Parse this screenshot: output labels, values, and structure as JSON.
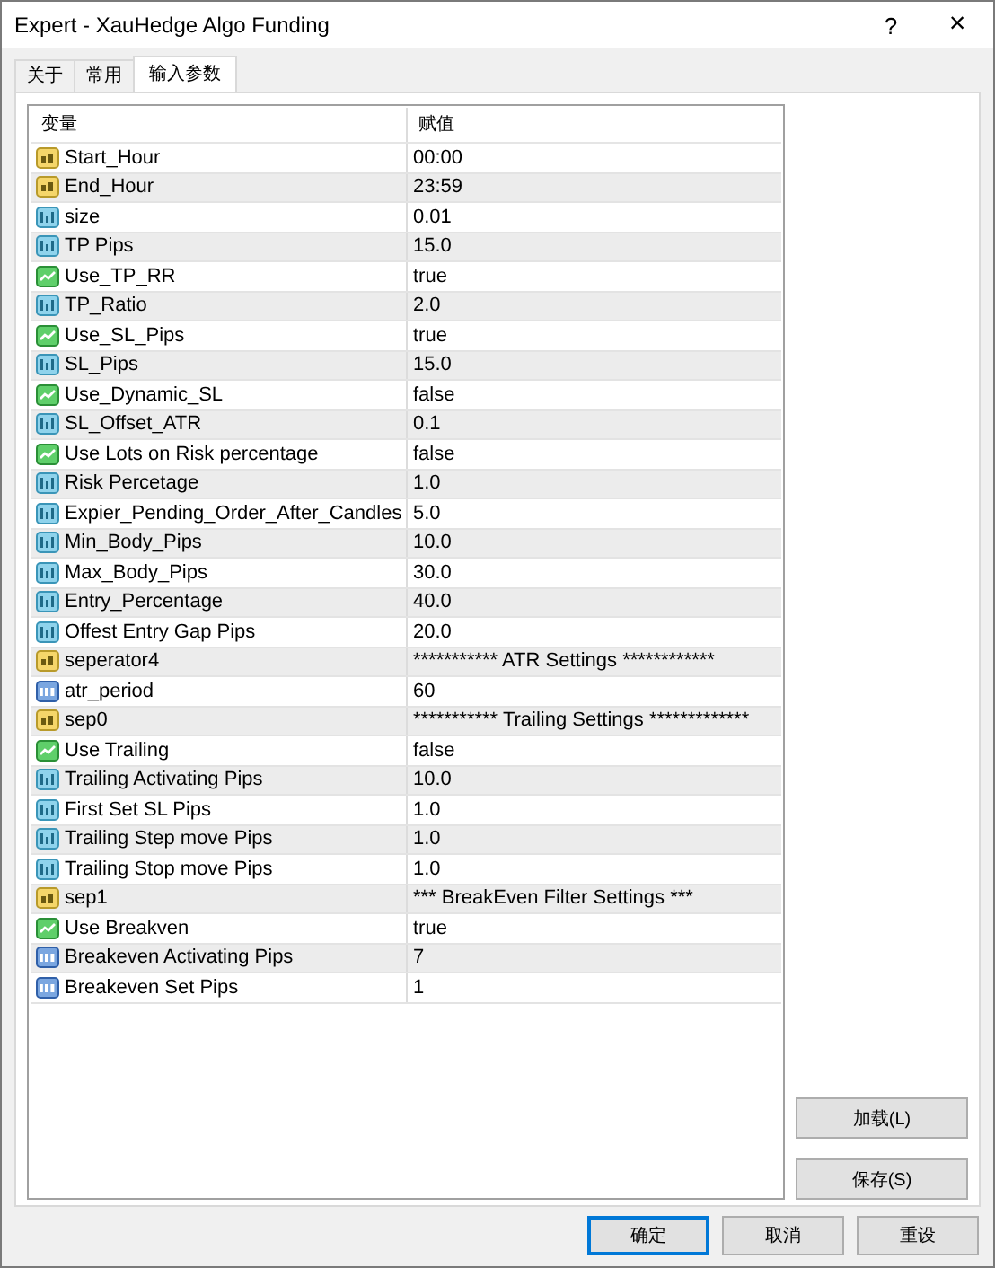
{
  "window": {
    "title": "Expert - XauHedge Algo Funding",
    "help": "?",
    "close": "×"
  },
  "tabs": [
    {
      "label": "关于",
      "selected": false
    },
    {
      "label": "常用",
      "selected": false
    },
    {
      "label": "输入参数",
      "selected": true
    }
  ],
  "table": {
    "columns": [
      "变量",
      "赋值"
    ],
    "rows": [
      {
        "kind": "string",
        "name": "Start_Hour",
        "value": "00:00"
      },
      {
        "kind": "string",
        "name": "End_Hour",
        "value": "23:59"
      },
      {
        "kind": "double",
        "name": "size",
        "value": "0.01"
      },
      {
        "kind": "double",
        "name": "TP Pips",
        "value": "15.0"
      },
      {
        "kind": "bool",
        "name": "Use_TP_RR",
        "value": "true"
      },
      {
        "kind": "double",
        "name": "TP_Ratio",
        "value": "2.0"
      },
      {
        "kind": "bool",
        "name": "Use_SL_Pips",
        "value": "true"
      },
      {
        "kind": "double",
        "name": "SL_Pips",
        "value": "15.0"
      },
      {
        "kind": "bool",
        "name": "Use_Dynamic_SL",
        "value": "false"
      },
      {
        "kind": "double",
        "name": "SL_Offset_ATR",
        "value": "0.1"
      },
      {
        "kind": "bool",
        "name": "Use Lots on Risk percentage",
        "value": "false"
      },
      {
        "kind": "double",
        "name": "Risk Percetage",
        "value": "1.0"
      },
      {
        "kind": "double",
        "name": "Expier_Pending_Order_After_Candles",
        "value": "5.0"
      },
      {
        "kind": "double",
        "name": "Min_Body_Pips",
        "value": "10.0"
      },
      {
        "kind": "double",
        "name": "Max_Body_Pips",
        "value": "30.0"
      },
      {
        "kind": "double",
        "name": "Entry_Percentage",
        "value": "40.0"
      },
      {
        "kind": "double",
        "name": "Offest Entry Gap Pips",
        "value": "20.0"
      },
      {
        "kind": "string",
        "name": "seperator4",
        "value": "***********   ATR Settings   ************"
      },
      {
        "kind": "int",
        "name": "atr_period",
        "value": "60"
      },
      {
        "kind": "string",
        "name": "sep0",
        "value": "*********** Trailing Settings *************"
      },
      {
        "kind": "bool",
        "name": "Use Trailing",
        "value": "false"
      },
      {
        "kind": "double",
        "name": "Trailing Activating Pips",
        "value": "10.0"
      },
      {
        "kind": "double",
        "name": "First Set SL  Pips",
        "value": "1.0"
      },
      {
        "kind": "double",
        "name": "Trailing Step move Pips",
        "value": "1.0"
      },
      {
        "kind": "double",
        "name": "Trailing Stop move Pips",
        "value": "1.0"
      },
      {
        "kind": "string",
        "name": "sep1",
        "value": "*** BreakEven Filter Settings ***"
      },
      {
        "kind": "bool",
        "name": "Use Breakven",
        "value": "true"
      },
      {
        "kind": "int",
        "name": "Breakeven Activating Pips",
        "value": "7"
      },
      {
        "kind": "int",
        "name": "Breakeven Set Pips",
        "value": "1"
      }
    ]
  },
  "side_buttons": [
    "加载(L)",
    "保存(S)"
  ],
  "buttons": [
    {
      "label": "确定",
      "default": true
    },
    {
      "label": "取消",
      "default": false
    },
    {
      "label": "重设",
      "default": false
    }
  ]
}
